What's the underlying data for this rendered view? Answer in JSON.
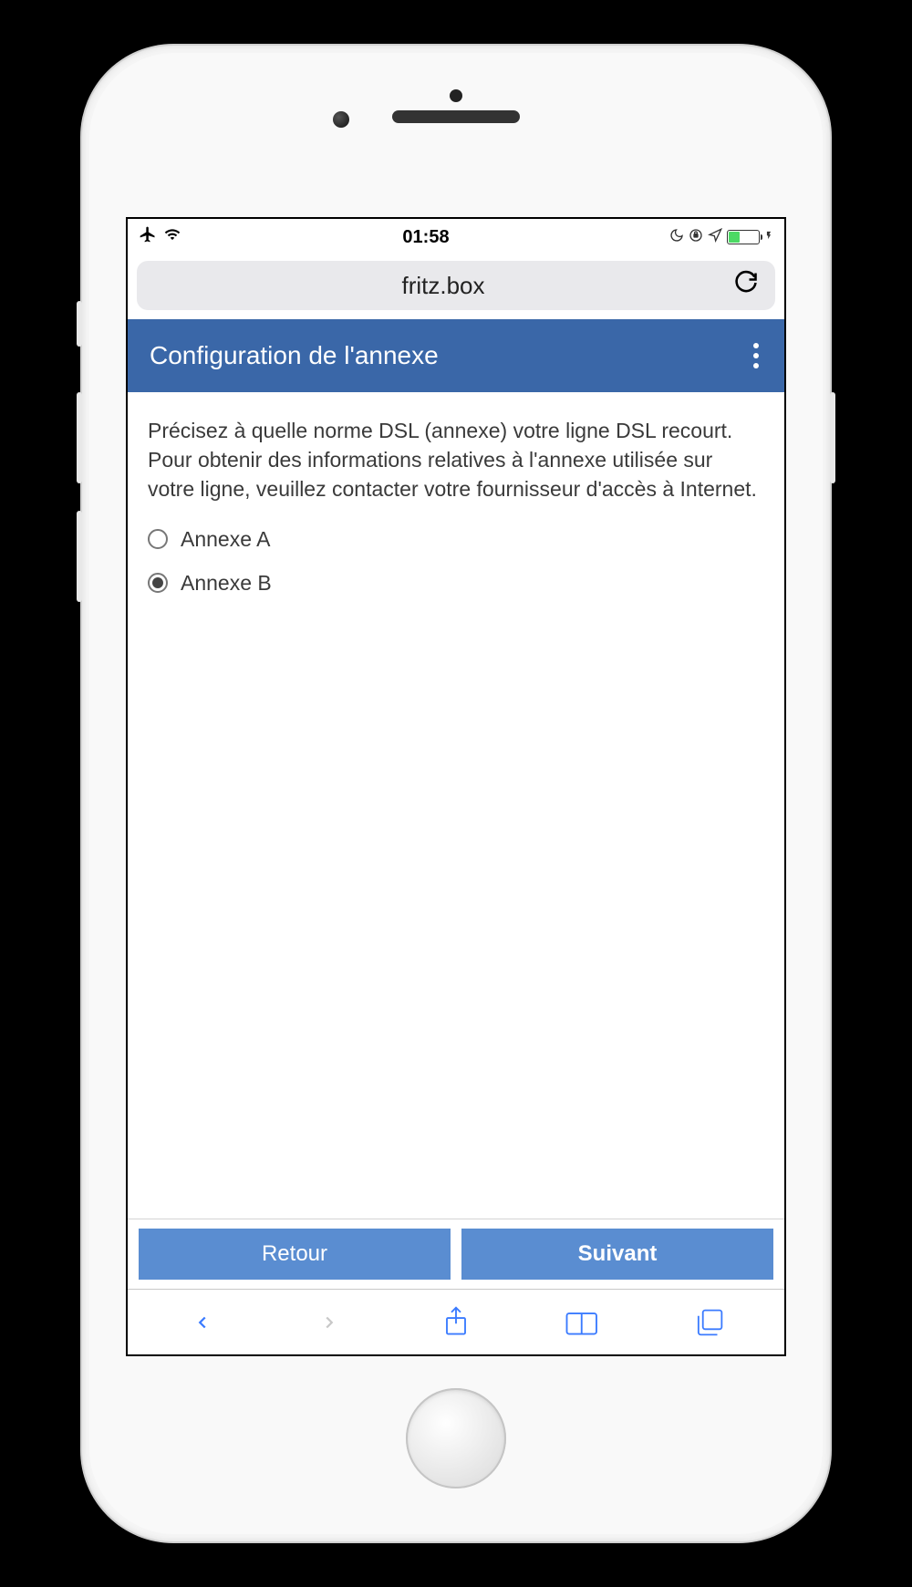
{
  "status_bar": {
    "time": "01:58"
  },
  "browser": {
    "url": "fritz.box"
  },
  "header": {
    "title": "Configuration de l'annexe"
  },
  "content": {
    "description": "Précisez à quelle norme DSL (annexe) votre ligne DSL recourt. Pour obtenir des informations relatives à l'annexe utilisée sur votre ligne, veuillez contacter votre fournisseur d'accès à Internet.",
    "options": [
      {
        "label": "Annexe A",
        "selected": false
      },
      {
        "label": "Annexe B",
        "selected": true
      }
    ]
  },
  "buttons": {
    "back": "Retour",
    "next": "Suivant"
  }
}
